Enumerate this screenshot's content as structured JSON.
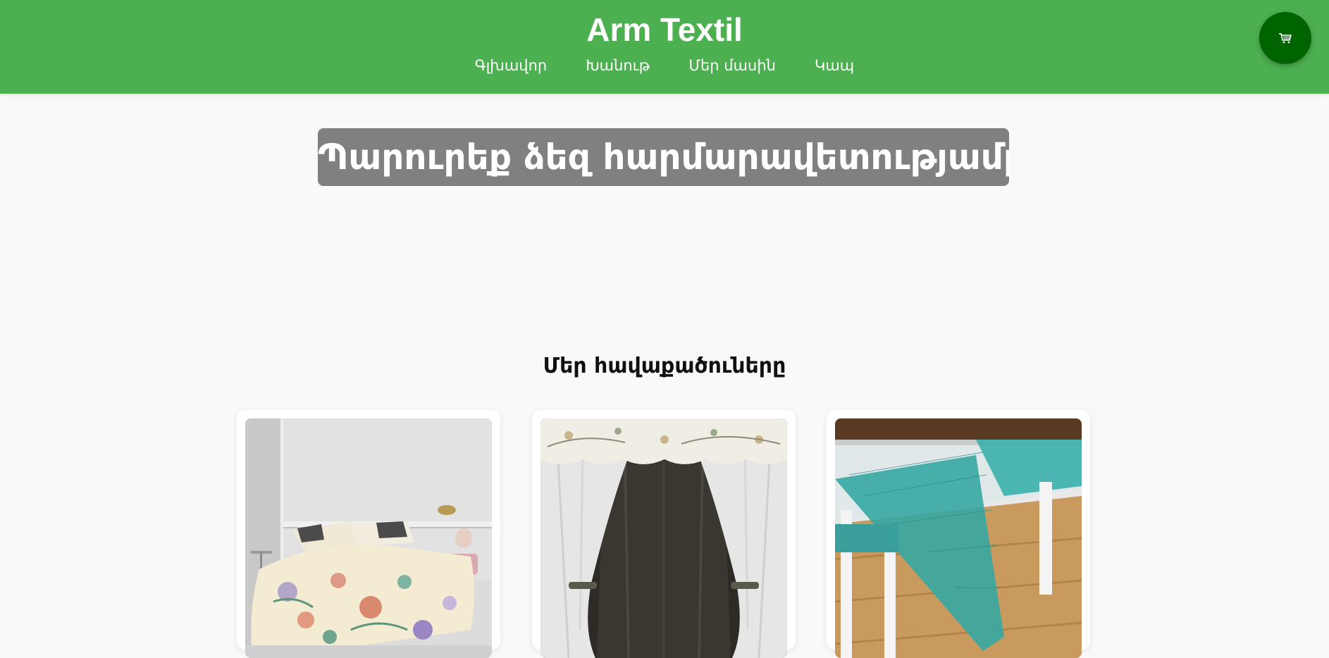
{
  "header": {
    "brand": "Arm Textil",
    "nav": [
      {
        "label": "Գլխավոր"
      },
      {
        "label": "Խանութ"
      },
      {
        "label": "Մեր մասին"
      },
      {
        "label": "Կապ"
      }
    ],
    "cart_icon": "cart-icon"
  },
  "hero": {
    "title": "Պարուրեք ձեզ հարմարավետությամբ"
  },
  "collections": {
    "title": "Մեր հավաքածուները",
    "items": [
      {
        "image": "floral-bedding-image"
      },
      {
        "image": "curtains-image"
      },
      {
        "image": "tablecloth-image"
      }
    ]
  },
  "colors": {
    "header": "#4caf50",
    "cart_button": "#006400",
    "background": "#f9f9f9"
  }
}
